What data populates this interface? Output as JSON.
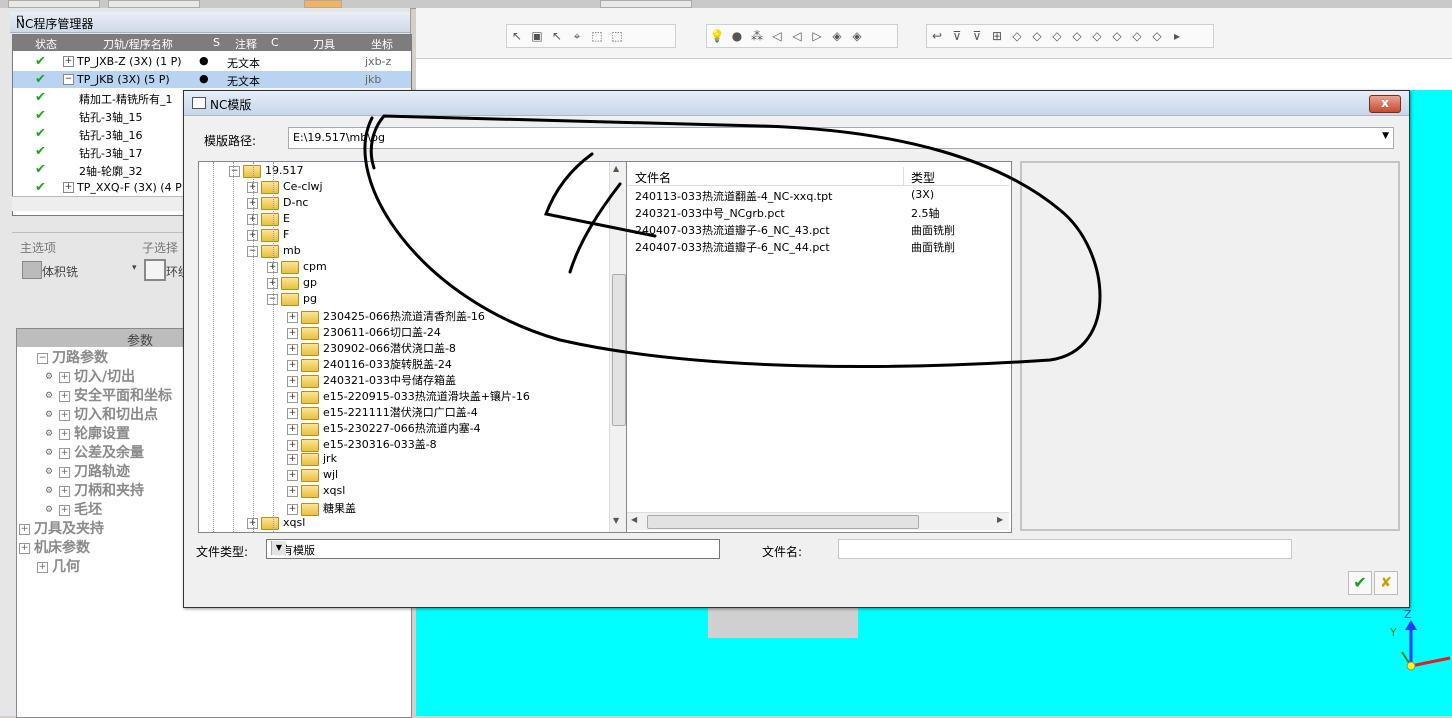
{
  "left_panel": {
    "title": "NC程序管理器",
    "pin": "⊓",
    "columns": [
      "状态",
      "刀轨/程序名称",
      "S",
      "注释",
      "C",
      "刀具",
      "坐标"
    ],
    "rows": [
      {
        "name": "TP_JXB-Z (3X) (1 P)",
        "note": "无文本",
        "tool": "jxb-z",
        "expand": "+",
        "selected": false
      },
      {
        "name": "TP_JKB (3X) (5 P)",
        "note": "无文本",
        "tool": "jkb",
        "expand": "−",
        "selected": true
      },
      {
        "name": "精加工-精铣所有_1",
        "note": "",
        "tool": "",
        "expand": "",
        "selected": false
      },
      {
        "name": "钻孔-3轴_15",
        "note": "",
        "tool": "",
        "expand": "",
        "selected": false
      },
      {
        "name": "钻孔-3轴_16",
        "note": "",
        "tool": "",
        "expand": "",
        "selected": false
      },
      {
        "name": "钻孔-3轴_17",
        "note": "",
        "tool": "",
        "expand": "",
        "selected": false
      },
      {
        "name": "2轴-轮廓_32",
        "note": "",
        "tool": "",
        "expand": "",
        "selected": false
      },
      {
        "name": "TP_XXQ-F (3X) (4 P",
        "note": "",
        "tool": "",
        "expand": "+",
        "selected": false
      }
    ],
    "main_option_label": "主选项",
    "sub_option_label": "子选择",
    "main_option_value": "体积铣",
    "sub_option_value": "环绕",
    "param_header": "参数",
    "params": [
      {
        "label": "刀路参数",
        "indent": 1,
        "expand": "−"
      },
      {
        "label": "切入/切出",
        "indent": 2,
        "expand": "+"
      },
      {
        "label": "安全平面和坐标",
        "indent": 2,
        "expand": "+"
      },
      {
        "label": "切入和切出点",
        "indent": 2,
        "expand": "+"
      },
      {
        "label": "轮廓设置",
        "indent": 2,
        "expand": "+"
      },
      {
        "label": "公差及余量",
        "indent": 2,
        "expand": "+"
      },
      {
        "label": "刀路轨迹",
        "indent": 2,
        "expand": "+"
      },
      {
        "label": "刀柄和夹持",
        "indent": 2,
        "expand": "+"
      },
      {
        "label": "毛坯",
        "indent": 2,
        "expand": "+"
      },
      {
        "label": "刀具及夹持",
        "indent": 0,
        "expand": "+"
      },
      {
        "label": "机床参数",
        "indent": 0,
        "expand": "+"
      },
      {
        "label": "几何",
        "indent": 1,
        "expand": "+"
      }
    ]
  },
  "dialog": {
    "title": "NC模版",
    "close": "x",
    "path_label": "模版路径:",
    "path_value": "E:\\19.517\\mb\\pg",
    "folders": [
      {
        "label": "19.517",
        "level": 0,
        "expand": "−"
      },
      {
        "label": "Ce-clwj",
        "level": 1,
        "expand": "+"
      },
      {
        "label": "D-nc",
        "level": 1,
        "expand": "+"
      },
      {
        "label": "E",
        "level": 1,
        "expand": "+"
      },
      {
        "label": "F",
        "level": 1,
        "expand": "+"
      },
      {
        "label": "mb",
        "level": 1,
        "expand": "−"
      },
      {
        "label": "cpm",
        "level": 2,
        "expand": "+"
      },
      {
        "label": "gp",
        "level": 2,
        "expand": "+"
      },
      {
        "label": "pg",
        "level": 2,
        "expand": "−"
      },
      {
        "label": "230425-066热流道清香剂盖-16",
        "level": 3,
        "expand": "+"
      },
      {
        "label": "230611-066切口盖-24",
        "level": 3,
        "expand": "+"
      },
      {
        "label": "230902-066潜伏浇口盖-8",
        "level": 3,
        "expand": "+"
      },
      {
        "label": "240116-033旋转脱盖-24",
        "level": 3,
        "expand": "+"
      },
      {
        "label": "240321-033中号储存箱盖",
        "level": 3,
        "expand": "+"
      },
      {
        "label": "e15-220915-033热流道滑块盖+镶片-16",
        "level": 3,
        "expand": "+"
      },
      {
        "label": "e15-221111潜伏浇口广口盖-4",
        "level": 3,
        "expand": "+"
      },
      {
        "label": "e15-230227-066热流道内塞-4",
        "level": 3,
        "expand": "+"
      },
      {
        "label": "e15-230316-033盖-8",
        "level": 3,
        "expand": "+"
      },
      {
        "label": "jrk",
        "level": 3,
        "expand": "+"
      },
      {
        "label": "wjl",
        "level": 3,
        "expand": "+"
      },
      {
        "label": "xqsl",
        "level": 3,
        "expand": "+"
      },
      {
        "label": "糖果盖",
        "level": 3,
        "expand": "+"
      },
      {
        "label": "xqsl",
        "level": 1,
        "expand": "+"
      }
    ],
    "file_col_name": "文件名",
    "file_col_type": "类型",
    "files": [
      {
        "name": "240113-033热流道翻盖-4_NC-xxq.tpt",
        "type": "(3X)"
      },
      {
        "name": "240321-033中号_NCgrb.pct",
        "type": "2.5轴"
      },
      {
        "name": "240407-033热流道瓣子-6_NC_43.pct",
        "type": "曲面铣削"
      },
      {
        "name": "240407-033热流道瓣子-6_NC_44.pct",
        "type": "曲面铣削"
      }
    ],
    "file_type_label": "文件类型:",
    "file_type_value": "所有模版",
    "file_name_label": "文件名:",
    "file_name_value": ""
  },
  "axis": {
    "z": "Z",
    "y": "Y"
  },
  "colors": {
    "viewport": "#00ffff",
    "check": "#1fa21f",
    "selection": "#b9d3f0",
    "folder": "#e9bf3f"
  }
}
